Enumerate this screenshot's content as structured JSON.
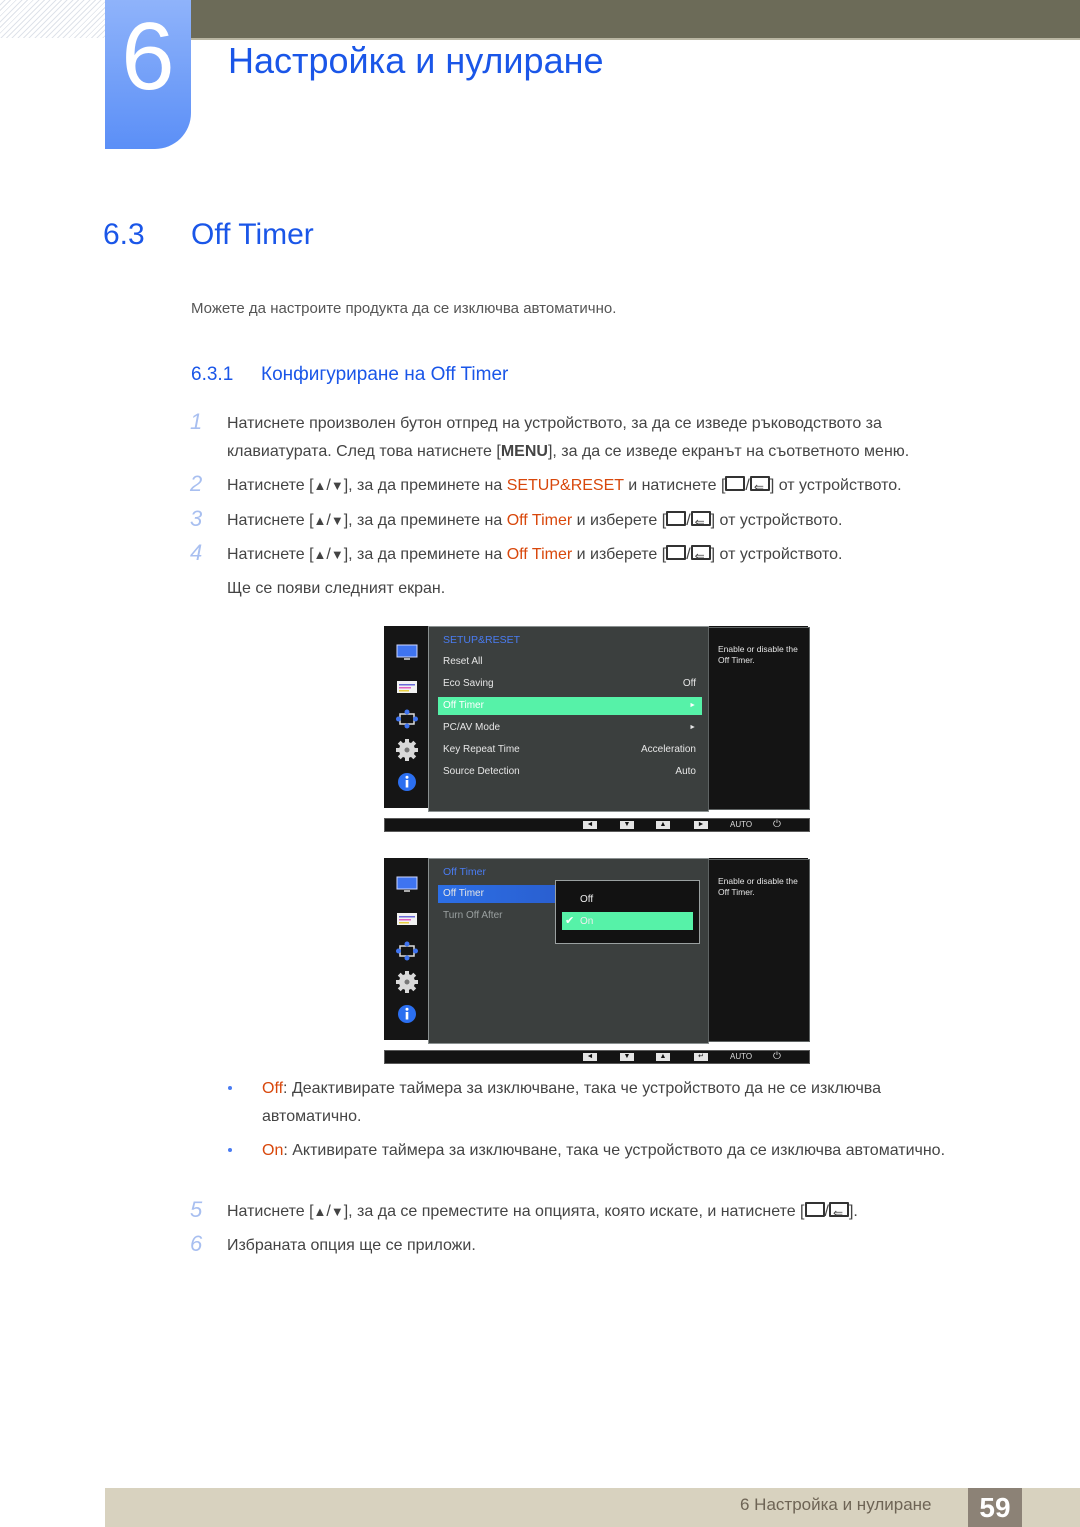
{
  "chapter": {
    "number": "6",
    "title": "Настройка и нулиране"
  },
  "section": {
    "number": "6.3",
    "title": "Off Timer",
    "intro": "Можете да настроите продукта да се изключва автоматично."
  },
  "subsection": {
    "number": "6.3.1",
    "title": "Конфигуриране на Off Timer"
  },
  "steps": [
    {
      "n": "1",
      "line1": "Натиснете произволен бутон отпред на устройството, за да се изведе ръководството за",
      "line2_pre": "клавиатурата. След това натиснете [",
      "line2_key": "MENU",
      "line2_post": "], за да се изведе екранът на съответното меню."
    },
    {
      "n": "2",
      "pre": "Натиснете [",
      "mid": "], за да преминете на ",
      "hl": "SETUP&RESET",
      "post": " и натиснете [",
      "end": "] от устройството."
    },
    {
      "n": "3",
      "pre": "Натиснете [",
      "mid": "], за да преминете на ",
      "hl": "Off Timer",
      "post": " и изберете [",
      "end": "] от устройството."
    },
    {
      "n": "4",
      "pre": "Натиснете [",
      "mid": "], за да преминете на ",
      "hl": "Off Timer",
      "post": " и изберете [",
      "end": "] от устройството.",
      "note": "Ще се появи следният екран."
    },
    {
      "n": "5",
      "pre": "Натиснете [",
      "mid": "], за да се преместите на опцията, която искате, и натиснете [",
      "end": "]."
    },
    {
      "n": "6",
      "text": "Избраната опция ще се приложи."
    }
  ],
  "symbols": {
    "up": "▲",
    "slash": "/",
    "down": "▼"
  },
  "osd1": {
    "header": "SETUP&RESET",
    "rows": [
      {
        "label": "Reset All",
        "value": ""
      },
      {
        "label": "Eco Saving",
        "value": "Off"
      },
      {
        "label": "Off Timer",
        "value": "►",
        "selected": true
      },
      {
        "label": "PC/AV Mode",
        "value": "►"
      },
      {
        "label": "Key Repeat Time",
        "value": "Acceleration"
      },
      {
        "label": "Source Detection",
        "value": "Auto"
      }
    ],
    "help": "Enable or disable the Off Timer.",
    "buttons": [
      "◄",
      "▼",
      "▲",
      "►"
    ],
    "auto": "AUTO",
    "power": "⏻"
  },
  "osd2": {
    "header": "Off Timer",
    "rows": [
      {
        "label": "Off Timer",
        "selected": true
      },
      {
        "label": "Turn Off After"
      }
    ],
    "popup": [
      {
        "label": "Off"
      },
      {
        "label": "On",
        "selected": true,
        "check": "✔"
      }
    ],
    "help": "Enable or disable the Off Timer.",
    "buttons": [
      "◄",
      "▼",
      "▲",
      "↵"
    ],
    "auto": "AUTO",
    "power": "⏻"
  },
  "bullets": [
    {
      "term": "Off",
      "text": ": Деактивирате таймера за изключване, така че устройството да не се изключва автоматично."
    },
    {
      "term": "On",
      "text": ": Активирате таймера за изключване, така че устройството да се изключва автоматично."
    }
  ],
  "footer": {
    "text": "6 Настройка и нулиране",
    "page": "59"
  }
}
